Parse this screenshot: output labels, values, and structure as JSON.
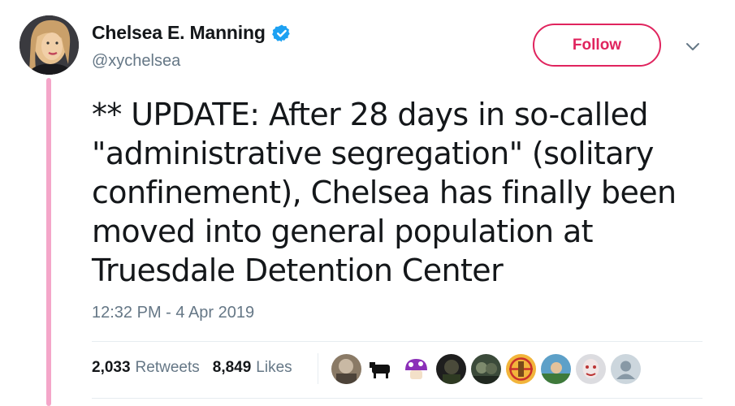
{
  "author": {
    "display_name": "Chelsea E. Manning",
    "handle": "@xychelsea",
    "verified": true
  },
  "follow_label": "Follow",
  "tweet": {
    "lines": [
      "** UPDATE: After 28 days in so-called",
      "\"administrative segregation\" (solitary",
      "confinement), Chelsea has finally been",
      "moved into general population at",
      "Truesdale Detention Center"
    ],
    "timestamp": "12:32 PM - 4 Apr 2019"
  },
  "stats": {
    "retweets_count": "2,033",
    "retweets_label": "Retweets",
    "likes_count": "8,849",
    "likes_label": "Likes"
  },
  "likers": [
    {
      "icon": "avatar-photo"
    },
    {
      "icon": "avatar-cow"
    },
    {
      "icon": "avatar-mushroom"
    },
    {
      "icon": "avatar-photo"
    },
    {
      "icon": "avatar-photo"
    },
    {
      "icon": "avatar-badge"
    },
    {
      "icon": "avatar-photo"
    },
    {
      "icon": "avatar-photo"
    },
    {
      "icon": "avatar-default"
    }
  ],
  "colors": {
    "accent": "#e0245e",
    "verified": "#1da1f2",
    "thread_line": "#f4a6c9",
    "muted_text": "#657786"
  }
}
